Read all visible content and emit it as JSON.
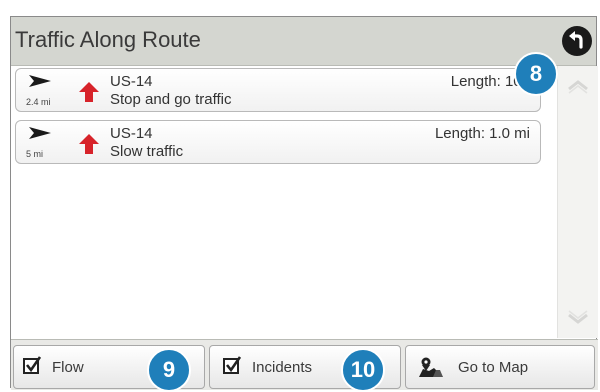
{
  "header": {
    "title": "Traffic Along Route",
    "back_icon": "back-arrow-icon"
  },
  "traffic_list": [
    {
      "direction_icon": "direction-arrow-icon",
      "distance": "2.4 mi",
      "alert_icon": "traffic-alert-icon",
      "road": "US-14",
      "description": "Stop and go traffic",
      "length": "Length: 100"
    },
    {
      "direction_icon": "direction-arrow-icon",
      "distance": "5 mi",
      "alert_icon": "traffic-alert-icon",
      "road": "US-14",
      "description": "Slow traffic",
      "length": "Length: 1.0 mi"
    }
  ],
  "bottom_bar": {
    "flow_label": "Flow",
    "flow_checked": true,
    "incidents_label": "Incidents",
    "incidents_checked": true,
    "go_to_map_label": "Go to Map"
  },
  "callouts": [
    "8",
    "9",
    "10"
  ],
  "colors": {
    "header_bg": "#d4d6d0",
    "alert_red": "#d7232a",
    "callout_blue": "#1f7fba"
  }
}
